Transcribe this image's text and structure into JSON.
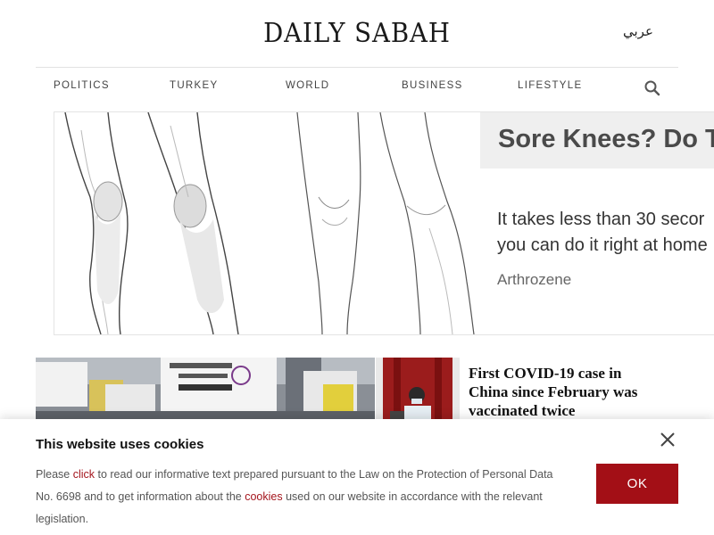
{
  "header": {
    "logo": "DAILY SABAH",
    "language_link": "عربي"
  },
  "nav": {
    "items": [
      {
        "label": "POLITICS"
      },
      {
        "label": "TURKEY"
      },
      {
        "label": "WORLD"
      },
      {
        "label": "BUSINESS"
      },
      {
        "label": "LIFESTYLE"
      }
    ],
    "search_icon": "search-icon"
  },
  "ad": {
    "headline": "Sore Knees? Do T",
    "body_line1": "It takes less than 30 secor",
    "body_line2": "you can do it right at home",
    "brand": "Arthrozene"
  },
  "news": {
    "headline": "First COVID-19 case in China since February was vaccinated twice"
  },
  "cookie_banner": {
    "title": "This website uses cookies",
    "text_before_click": "Please ",
    "click_link": "click",
    "text_after_click": " to read our informative text prepared pursuant to the Law on the Protection of Personal Data No. 6698 and to get information about the ",
    "cookies_link": "cookies",
    "text_end": " used on our website in accordance with the relevant legislation.",
    "ok_label": "OK",
    "close_icon": "close-icon"
  },
  "colors": {
    "accent": "#a30f16",
    "link": "#a5161e"
  }
}
